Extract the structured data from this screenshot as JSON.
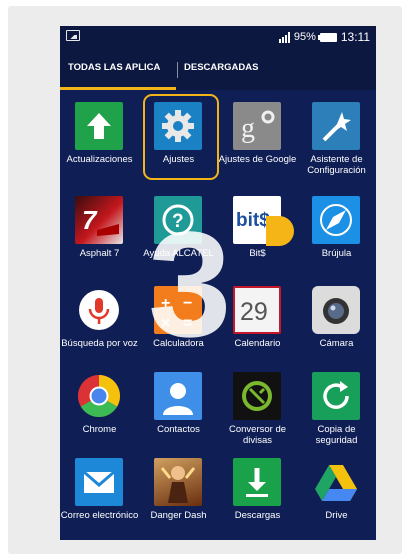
{
  "status_bar": {
    "battery_percent": "95%",
    "time": "13:11"
  },
  "tabs": [
    {
      "label": "TODAS LAS APLICA",
      "selected": true
    },
    {
      "label": "DESCARGADAS",
      "selected": false
    }
  ],
  "apps": [
    {
      "label": "Actualizaciones",
      "icon": "up-arrow-icon",
      "color": "#1fa24a"
    },
    {
      "label": "Ajustes",
      "icon": "gear-icon",
      "color": "#1a82c4"
    },
    {
      "label": "Ajustes de Google",
      "icon": "google-settings-icon",
      "color": "#8a8a8a"
    },
    {
      "label": "Asistente de Configuración",
      "icon": "wand-icon",
      "color": "#2c7fb8"
    },
    {
      "label": "Asphalt 7",
      "icon": "race-car-icon",
      "color": "#c4181e"
    },
    {
      "label": "Ayuda ALCATEL",
      "icon": "help-icon",
      "color": "#2aa6a0"
    },
    {
      "label": "Bit$",
      "icon": "bits-icon",
      "color": "#ffffff"
    },
    {
      "label": "Brújula",
      "icon": "compass-icon",
      "color": "#1b90e4"
    },
    {
      "label": "Búsqueda por voz",
      "icon": "microphone-icon",
      "color": "#ffffff"
    },
    {
      "label": "Calculadora",
      "icon": "calculator-icon",
      "color": "#f37c1c"
    },
    {
      "label": "Calendario",
      "icon": "calendar-icon",
      "color": "#ffffff"
    },
    {
      "label": "Cámara",
      "icon": "camera-icon",
      "color": "#e0e0e0"
    },
    {
      "label": "Chrome",
      "icon": "chrome-icon",
      "color": "#ffffff"
    },
    {
      "label": "Contactos",
      "icon": "contacts-icon",
      "color": "#3f8ee8"
    },
    {
      "label": "Conversor de divisas",
      "icon": "currency-converter-icon",
      "color": "#111111"
    },
    {
      "label": "Copia de seguridad",
      "icon": "backup-icon",
      "color": "#18a05a"
    },
    {
      "label": "Correo electrónico",
      "icon": "mail-icon",
      "color": "#1e88d8"
    },
    {
      "label": "Danger Dash",
      "icon": "danger-dash-icon",
      "color": "#8a4a22"
    },
    {
      "label": "Descargas",
      "icon": "download-icon",
      "color": "#1aa24a"
    },
    {
      "label": "Drive",
      "icon": "drive-icon",
      "color": "#ffffff"
    }
  ],
  "calendar_day": "29",
  "bits_icon_text": "bit$",
  "calculator_symbols": {
    "plus": "+",
    "minus": "−",
    "times": "×",
    "equals": "="
  },
  "overlay_step": "3",
  "accent_color": "#f2b416"
}
